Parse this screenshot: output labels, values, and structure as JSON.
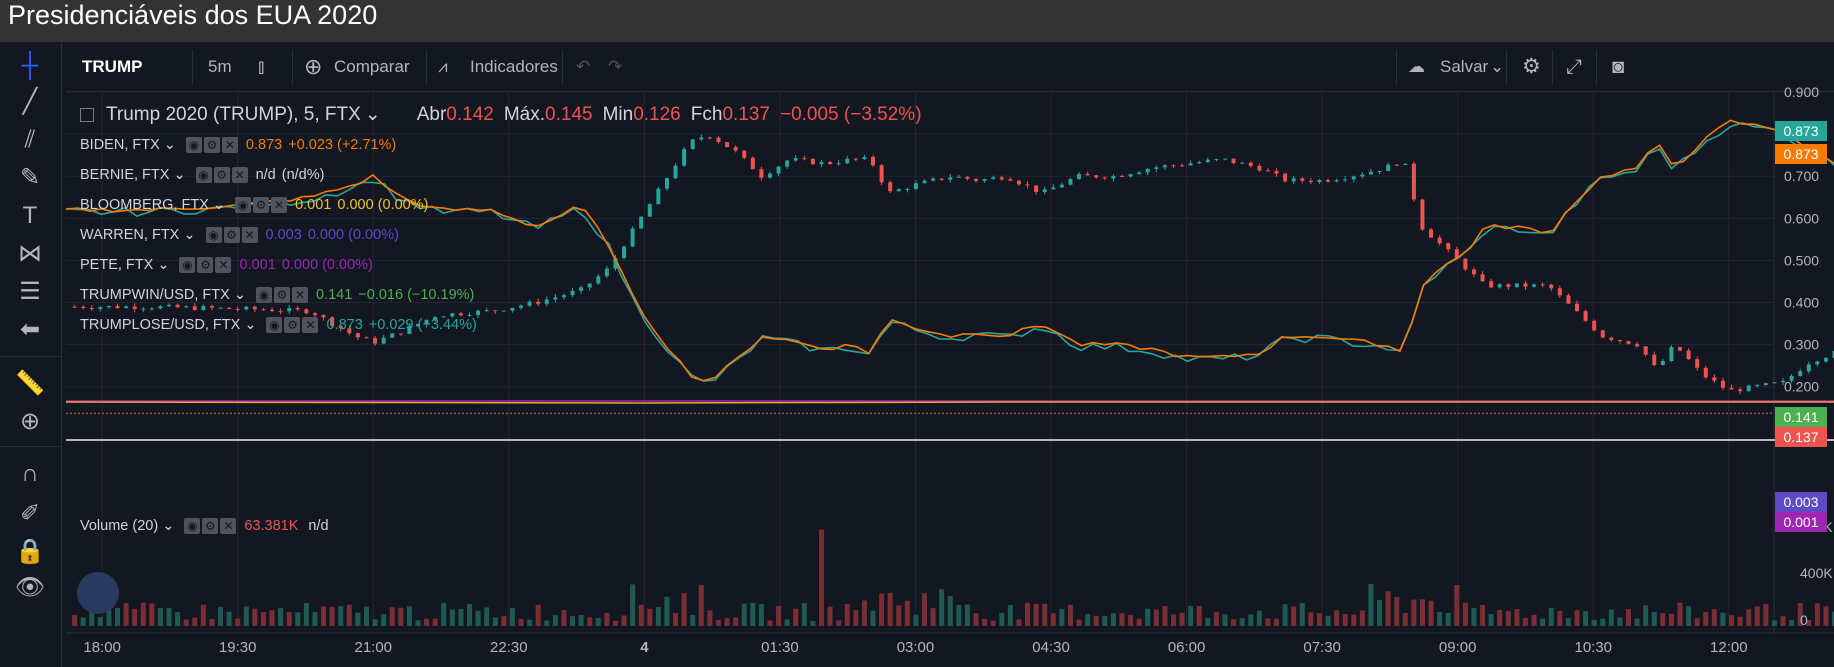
{
  "page": {
    "title": "Presidenciáveis dos EUA 2020"
  },
  "toolbar": {
    "symbol": "TRUMP",
    "interval": "5m",
    "compare_label": "Comparar",
    "indicators_label": "Indicadores",
    "save_label": "Salvar"
  },
  "legend": {
    "main": {
      "title": "Trump 2020 (TRUMP), 5, FTX",
      "open_label": "Abr",
      "open": "0.142",
      "high_label": "Máx.",
      "high": "0.145",
      "low_label": "Min",
      "low": "0.126",
      "close_label": "Fch",
      "close": "0.137",
      "change": "−0.005 (−3.52%)"
    },
    "overlays": [
      {
        "name": "BIDEN, FTX",
        "value": "0.873",
        "change": "+0.023 (+2.71%)",
        "color": "#f57c00"
      },
      {
        "name": "BERNIE, FTX",
        "value": "n/d",
        "change": "(n/d%)",
        "color": "#d1d4dc"
      },
      {
        "name": "BLOOMBERG, FTX",
        "value": "0.001",
        "change": "0.000 (0.00%)",
        "color": "#f6c026"
      },
      {
        "name": "WARREN, FTX",
        "value": "0.003",
        "change": "0.000 (0.00%)",
        "color": "#5e49c7"
      },
      {
        "name": "PETE, FTX",
        "value": "0.001",
        "change": "0.000 (0.00%)",
        "color": "#9c27b0"
      },
      {
        "name": "TRUMPWIN/USD, FTX",
        "value": "0.141",
        "change": "−0.016 (−10.19%)",
        "color": "#4caf50"
      },
      {
        "name": "TRUMPLOSE/USD, FTX",
        "value": "0.873",
        "change": "+0.029 (+3.44%)",
        "color": "#26a69a"
      }
    ],
    "volume": {
      "name": "Volume (20)",
      "value": "63.381K",
      "extra": "n/d"
    }
  },
  "colors": {
    "up": "#26a69a",
    "down": "#ef5350",
    "biden": "#f57c00",
    "trumplose": "#26a69a",
    "trumpwin": "#4caf50"
  },
  "chart_data": {
    "type": "line",
    "x_ticks": [
      "18:00",
      "19:30",
      "21:00",
      "22:30",
      "4",
      "01:30",
      "03:00",
      "04:30",
      "06:00",
      "07:30",
      "09:00",
      "10:30",
      "12:00"
    ],
    "y_ticks": [
      "0.200",
      "0.300",
      "0.400",
      "0.500",
      "0.600",
      "0.700",
      "0.800",
      "0.900"
    ],
    "ylim": [
      0.14,
      0.9
    ],
    "x_range_hours": [
      17.6,
      36.5
    ],
    "trump_close": [
      [
        17.6,
        0.39
      ],
      [
        18.5,
        0.39
      ],
      [
        19.5,
        0.385
      ],
      [
        20.3,
        0.38
      ],
      [
        20.8,
        0.32
      ],
      [
        21.0,
        0.305
      ],
      [
        21.3,
        0.33
      ],
      [
        21.7,
        0.37
      ],
      [
        22.3,
        0.38
      ],
      [
        22.8,
        0.4
      ],
      [
        23.3,
        0.43
      ],
      [
        23.6,
        0.48
      ],
      [
        23.9,
        0.58
      ],
      [
        24.2,
        0.68
      ],
      [
        24.5,
        0.78
      ],
      [
        24.7,
        0.8
      ],
      [
        25.0,
        0.76
      ],
      [
        25.3,
        0.7
      ],
      [
        25.6,
        0.74
      ],
      [
        26.0,
        0.73
      ],
      [
        26.3,
        0.74
      ],
      [
        26.5,
        0.74
      ],
      [
        26.7,
        0.66
      ],
      [
        27.0,
        0.68
      ],
      [
        27.4,
        0.7
      ],
      [
        27.7,
        0.69
      ],
      [
        28.0,
        0.7
      ],
      [
        28.4,
        0.66
      ],
      [
        28.8,
        0.7
      ],
      [
        29.2,
        0.7
      ],
      [
        29.6,
        0.72
      ],
      [
        30.0,
        0.73
      ],
      [
        30.4,
        0.74
      ],
      [
        30.8,
        0.72
      ],
      [
        31.1,
        0.69
      ],
      [
        31.5,
        0.69
      ],
      [
        31.8,
        0.7
      ],
      [
        32.2,
        0.72
      ],
      [
        32.4,
        0.74
      ],
      [
        32.6,
        0.58
      ],
      [
        32.8,
        0.54
      ],
      [
        33.1,
        0.48
      ],
      [
        33.3,
        0.44
      ],
      [
        33.7,
        0.44
      ],
      [
        34.0,
        0.44
      ],
      [
        34.3,
        0.38
      ],
      [
        34.6,
        0.32
      ],
      [
        35.0,
        0.3
      ],
      [
        35.2,
        0.24
      ],
      [
        35.4,
        0.3
      ],
      [
        35.7,
        0.23
      ],
      [
        36.0,
        0.19
      ],
      [
        36.3,
        0.2
      ],
      [
        36.6,
        0.21
      ],
      [
        36.9,
        0.26
      ],
      [
        37.3,
        0.29
      ],
      [
        37.6,
        0.28
      ],
      [
        37.9,
        0.18
      ],
      [
        38.3,
        0.16
      ],
      [
        38.5,
        0.137
      ]
    ],
    "biden_line": [
      [
        17.6,
        0.62
      ],
      [
        18.5,
        0.62
      ],
      [
        19.5,
        0.63
      ],
      [
        20.3,
        0.65
      ],
      [
        20.8,
        0.68
      ],
      [
        21.0,
        0.7
      ],
      [
        21.3,
        0.65
      ],
      [
        21.7,
        0.62
      ],
      [
        22.3,
        0.62
      ],
      [
        22.8,
        0.58
      ],
      [
        23.3,
        0.63
      ],
      [
        23.6,
        0.54
      ],
      [
        23.9,
        0.4
      ],
      [
        24.2,
        0.31
      ],
      [
        24.5,
        0.23
      ],
      [
        24.7,
        0.21
      ],
      [
        25.0,
        0.26
      ],
      [
        25.3,
        0.32
      ],
      [
        25.6,
        0.31
      ],
      [
        26.0,
        0.29
      ],
      [
        26.3,
        0.3
      ],
      [
        26.5,
        0.28
      ],
      [
        26.7,
        0.36
      ],
      [
        27.0,
        0.34
      ],
      [
        27.4,
        0.32
      ],
      [
        27.7,
        0.33
      ],
      [
        28.0,
        0.32
      ],
      [
        28.4,
        0.35
      ],
      [
        28.8,
        0.3
      ],
      [
        29.2,
        0.3
      ],
      [
        29.6,
        0.29
      ],
      [
        30.0,
        0.27
      ],
      [
        30.4,
        0.27
      ],
      [
        30.8,
        0.28
      ],
      [
        31.1,
        0.32
      ],
      [
        31.5,
        0.32
      ],
      [
        31.8,
        0.31
      ],
      [
        32.2,
        0.3
      ],
      [
        32.4,
        0.28
      ],
      [
        32.6,
        0.44
      ],
      [
        32.8,
        0.48
      ],
      [
        33.1,
        0.52
      ],
      [
        33.3,
        0.58
      ],
      [
        33.7,
        0.58
      ],
      [
        34.0,
        0.56
      ],
      [
        34.3,
        0.64
      ],
      [
        34.6,
        0.7
      ],
      [
        35.0,
        0.72
      ],
      [
        35.2,
        0.78
      ],
      [
        35.4,
        0.72
      ],
      [
        35.7,
        0.78
      ],
      [
        36.0,
        0.83
      ],
      [
        36.3,
        0.82
      ],
      [
        36.6,
        0.81
      ],
      [
        36.9,
        0.76
      ],
      [
        37.3,
        0.72
      ],
      [
        37.6,
        0.73
      ],
      [
        37.9,
        0.84
      ],
      [
        38.3,
        0.85
      ],
      [
        38.5,
        0.873
      ]
    ],
    "bottom_lines_value": [
      0.003,
      0.001
    ],
    "last_labels": [
      {
        "value": "0.873",
        "color": "#26a69a",
        "yval": 0.873
      },
      {
        "value": "0.873",
        "color": "#f57c00",
        "yval": 0.873
      },
      {
        "value": "0.141",
        "color": "#4caf50",
        "yval": 0.141
      },
      {
        "value": "0.137",
        "color": "#ef5350",
        "yval": 0.137
      },
      {
        "value": "0.003",
        "color": "#5e49c7",
        "yval": 0.003
      },
      {
        "value": "0.001",
        "color": "#9c27b0",
        "yval": 0.001
      }
    ],
    "volume_ticks": [
      "800K",
      "400K",
      "0"
    ],
    "volume_max": 900000,
    "volume_peak": 850000
  }
}
